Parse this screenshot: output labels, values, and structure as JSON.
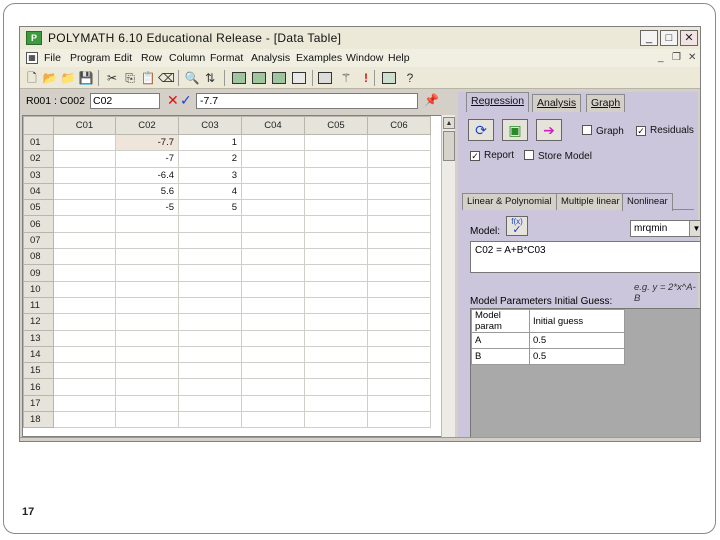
{
  "window": {
    "title": "POLYMATH 6.10 Educational Release - [Data Table]",
    "icon_label": "P",
    "controls": {
      "minimize": "_",
      "maximize": "□",
      "close": "✕"
    }
  },
  "menu": {
    "items": [
      "File",
      "Program",
      "Edit",
      "Row",
      "Column",
      "Format",
      "Analysis",
      "Examples",
      "Window",
      "Help"
    ],
    "mdi_controls": {
      "minimize": "_",
      "restore": "❐",
      "close": "✕"
    }
  },
  "toolbar": {
    "icons": [
      "new-file-icon",
      "open-folder-icon",
      "open-file-icon",
      "save-icon",
      "cut-icon",
      "copy-icon",
      "paste-icon",
      "eraser-icon",
      "find-icon",
      "sort-icon",
      "linear-eq-icon",
      "nonlinear-eq-icon",
      "diff-eq-icon",
      "regression-icon",
      "calculator-icon",
      "wand-icon",
      "exclamation-icon",
      "table-icon",
      "help-icon"
    ]
  },
  "cellbar": {
    "reference": "R001 : C002",
    "name_value": "C02",
    "formula_value": "-7.7"
  },
  "grid": {
    "columns": [
      "C01",
      "C02",
      "C03",
      "C04",
      "C05",
      "C06"
    ],
    "rows": [
      {
        "label": "01",
        "cells": [
          "",
          "-7.7",
          "1",
          "",
          "",
          ""
        ]
      },
      {
        "label": "02",
        "cells": [
          "",
          "-7",
          "2",
          "",
          "",
          ""
        ]
      },
      {
        "label": "03",
        "cells": [
          "",
          "-6.4",
          "3",
          "",
          "",
          ""
        ]
      },
      {
        "label": "04",
        "cells": [
          "",
          "5.6",
          "4",
          "",
          "",
          ""
        ]
      },
      {
        "label": "05",
        "cells": [
          "",
          "-5",
          "5",
          "",
          "",
          ""
        ]
      },
      {
        "label": "06",
        "cells": [
          "",
          "",
          "",
          "",
          "",
          ""
        ]
      },
      {
        "label": "07",
        "cells": [
          "",
          "",
          "",
          "",
          "",
          ""
        ]
      },
      {
        "label": "08",
        "cells": [
          "",
          "",
          "",
          "",
          "",
          ""
        ]
      },
      {
        "label": "09",
        "cells": [
          "",
          "",
          "",
          "",
          "",
          ""
        ]
      },
      {
        "label": "10",
        "cells": [
          "",
          "",
          "",
          "",
          "",
          ""
        ]
      },
      {
        "label": "11",
        "cells": [
          "",
          "",
          "",
          "",
          "",
          ""
        ]
      },
      {
        "label": "12",
        "cells": [
          "",
          "",
          "",
          "",
          "",
          ""
        ]
      },
      {
        "label": "13",
        "cells": [
          "",
          "",
          "",
          "",
          "",
          ""
        ]
      },
      {
        "label": "14",
        "cells": [
          "",
          "",
          "",
          "",
          "",
          ""
        ]
      },
      {
        "label": "15",
        "cells": [
          "",
          "",
          "",
          "",
          "",
          ""
        ]
      },
      {
        "label": "16",
        "cells": [
          "",
          "",
          "",
          "",
          "",
          ""
        ]
      },
      {
        "label": "17",
        "cells": [
          "",
          "",
          "",
          "",
          "",
          ""
        ]
      },
      {
        "label": "18",
        "cells": [
          "",
          "",
          "",
          "",
          "",
          ""
        ]
      }
    ],
    "selected_row": 0,
    "selected_col": 1
  },
  "panel": {
    "tabs": [
      "Regression",
      "Analysis",
      "Graph"
    ],
    "active_tab": 0,
    "buttons": {
      "refresh": "⟳",
      "solve": "▣",
      "go": "➔"
    },
    "options": {
      "graph": {
        "label": "Graph",
        "checked": false
      },
      "residuals": {
        "label": "Residuals",
        "checked": true
      },
      "report": {
        "label": "Report",
        "checked": true
      },
      "store_model": {
        "label": "Store Model",
        "checked": false
      }
    },
    "subtabs": [
      "Linear & Polynomial",
      "Multiple linear",
      "Nonlinear"
    ],
    "active_subtab": 2,
    "model_label": "Model:",
    "fx_button": "f(x)",
    "method": "mrqmin",
    "model_equation": "C02 = A+B*C03",
    "example_hint": "e.g. y = 2*x^A-B",
    "params_title": "Model Parameters Initial Guess:",
    "params_columns": [
      "Model param",
      "Initial guess"
    ],
    "params": [
      {
        "name": "A",
        "guess": "0.5"
      },
      {
        "name": "B",
        "guess": "0.5"
      }
    ]
  },
  "slide_number": "17",
  "colors": {
    "panel_bg": "#ccc6dc",
    "selected_cell": "#f0e5da",
    "x_red": "#d11111",
    "check_blue": "#1b3fd1"
  }
}
